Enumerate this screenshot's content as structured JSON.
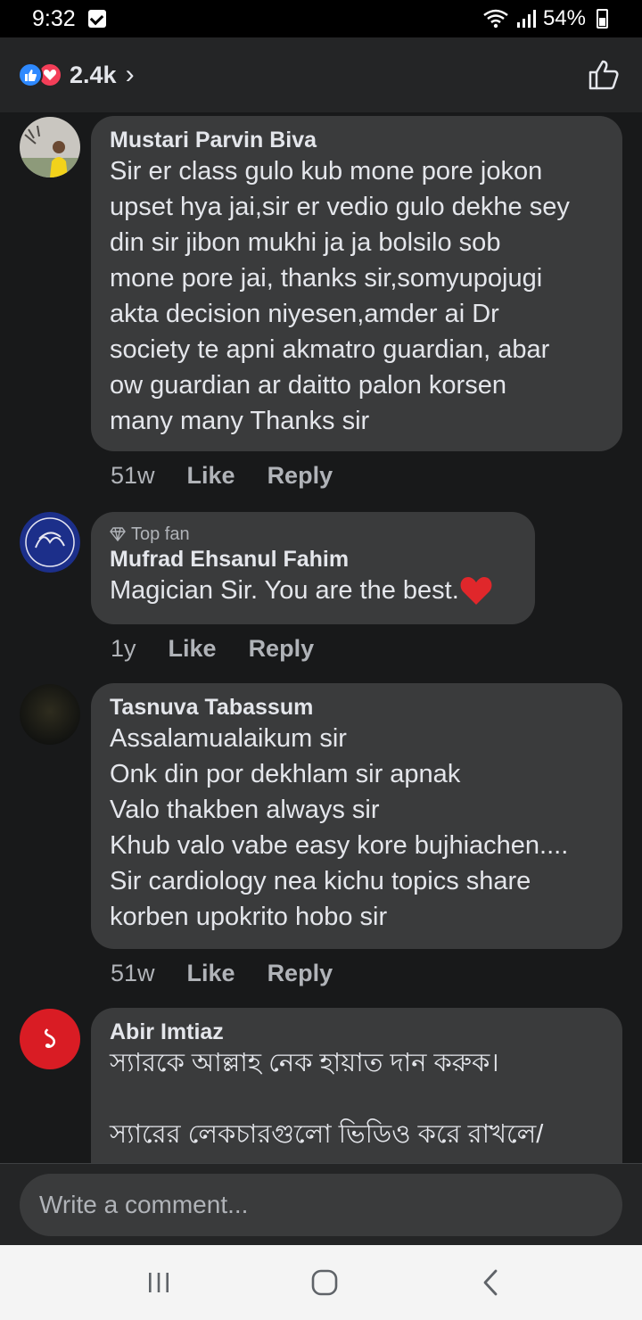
{
  "status_bar": {
    "time": "9:32",
    "battery": "54%"
  },
  "reactions": {
    "count": "2.4k",
    "chevron": "›"
  },
  "comments": [
    {
      "name": "Mustari Parvin Biva",
      "text": "Sir er class gulo kub mone pore jokon\nupset hya jai,sir er vedio gulo dekhe sey\ndin sir jibon mukhi ja ja bolsilo sob\nmone pore jai, thanks sir,somyupojugi\nakta decision niyesen,amder ai Dr\nsociety te apni akmatro guardian, abar\now guardian ar daitto palon korsen\nmany many Thanks sir",
      "age": "51w",
      "like": "Like",
      "reply": "Reply"
    },
    {
      "badge": "Top fan",
      "name": "Mufrad Ehsanul Fahim",
      "text": "Magician Sir. You are the best.",
      "age": "1y",
      "like": "Like",
      "reply": "Reply"
    },
    {
      "name": "Tasnuva Tabassum",
      "text": "Assalamualaikum sir\nOnk din por dekhlam sir apnak\nValo thakben always sir\nKhub valo vabe easy kore bujhiachen....\nSir cardiology nea kichu topics share\nkorben upokrito hobo sir",
      "age": "51w",
      "like": "Like",
      "reply": "Reply"
    },
    {
      "name": "Abir Imtiaz",
      "text": "স্যারকে আল্লাহ নেক হায়াত দান করুক।\n\nস্যারের লেকচারগুলো ভিডিও করে রাখলে/",
      "avatar_glyph": "১"
    }
  ],
  "composer": {
    "placeholder": "Write a comment..."
  },
  "colors": {
    "background": "#18191a",
    "bubble": "#3a3b3c",
    "like_blue": "#2e89ff",
    "love_red": "#f33e58",
    "heart_red": "#e0272b"
  },
  "icons": [
    "wifi-icon",
    "signal-icon",
    "battery-icon",
    "like-reaction-icon",
    "love-reaction-icon",
    "thumbs-up-icon",
    "diamond-icon",
    "heart-emoji-icon",
    "recent-apps-icon",
    "home-icon",
    "back-icon"
  ]
}
